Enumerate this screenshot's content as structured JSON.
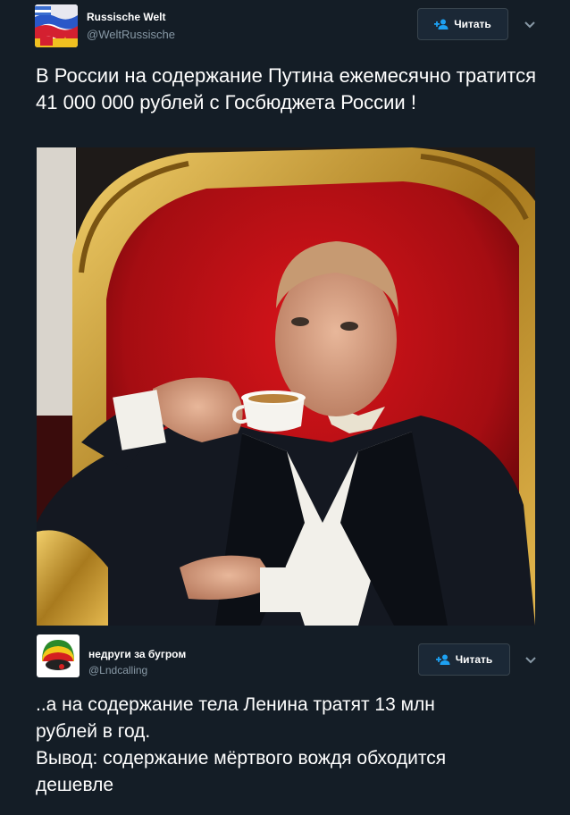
{
  "tweet1": {
    "display_name": "Russische Welt",
    "handle": "@WeltRussische",
    "follow_label": "Читать",
    "text": "В России на содержание Путина ежемесячно тратится 41 000 000 рублей с Госбюджета России !",
    "avatar_icon": "flag-collage-avatar",
    "photo_icon": "man-drinking-tea-in-throne-photo"
  },
  "tweet2": {
    "display_name": "недруги за бугром",
    "handle": "@Lndcalling",
    "follow_label": "Читать",
    "text": "..а на содержание тела Ленина тратят 13 млн рублей в год.\nВывод: содержание мёртвого вождя обходится дешевле",
    "avatar_icon": "rasta-hat-avatar"
  },
  "colors": {
    "background": "#141d26",
    "text": "#ffffff",
    "secondary_text": "#8899a6",
    "accent": "#1da1f2"
  }
}
